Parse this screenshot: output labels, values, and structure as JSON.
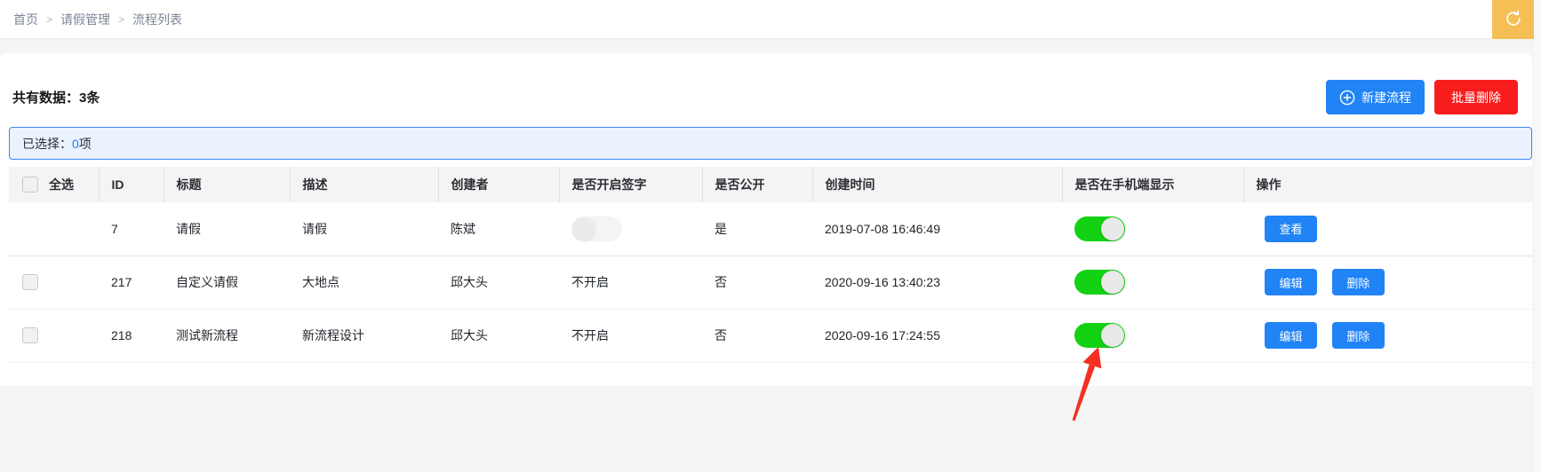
{
  "breadcrumb": {
    "items": [
      "首页",
      "请假管理",
      "流程列表"
    ],
    "separator": ">"
  },
  "topbar": {
    "refresh_icon": "refresh-icon",
    "refresh_color": "#f5bf55"
  },
  "toolbar": {
    "total_label": "共有数据：3条",
    "create_button": "新建流程",
    "create_icon": "plus-circle-icon",
    "batch_delete_button": "批量删除"
  },
  "selection_bar": {
    "prefix": "已选择：",
    "count": "0",
    "suffix": "项"
  },
  "table": {
    "headers": [
      "全选",
      "ID",
      "标题",
      "描述",
      "创建者",
      "是否开启签字",
      "是否公开",
      "创建时间",
      "是否在手机端显示",
      "操作"
    ],
    "rows": [
      {
        "has_checkbox": false,
        "id": "7",
        "title": "请假",
        "description": "请假",
        "creator": "陈斌",
        "signature_toggle": "off-disabled",
        "signature_text": "",
        "public": "是",
        "created_at": "2019-07-08 16:46:49",
        "mobile_toggle": "on",
        "actions": [
          "查看"
        ]
      },
      {
        "has_checkbox": true,
        "id": "217",
        "title": "自定义请假",
        "description": "大地点",
        "creator": "邱大头",
        "signature_toggle": "",
        "signature_text": "不开启",
        "public": "否",
        "created_at": "2020-09-16 13:40:23",
        "mobile_toggle": "on",
        "actions": [
          "编辑",
          "删除"
        ]
      },
      {
        "has_checkbox": true,
        "id": "218",
        "title": "测试新流程",
        "description": "新流程设计",
        "creator": "邱大头",
        "signature_toggle": "",
        "signature_text": "不开启",
        "public": "否",
        "created_at": "2020-09-16 17:24:55",
        "mobile_toggle": "on",
        "actions": [
          "编辑",
          "删除"
        ]
      }
    ]
  },
  "annotation": {
    "type": "red-arrow",
    "points_at": "row-218-mobile-toggle",
    "color": "#f53022"
  },
  "colors": {
    "primary_blue": "#2083f6",
    "danger_red": "#f81d1d",
    "toggle_green": "#13d213",
    "header_orange": "#f5bf55",
    "selection_border": "#3f83f7",
    "selection_bg": "#e9f2fd"
  }
}
